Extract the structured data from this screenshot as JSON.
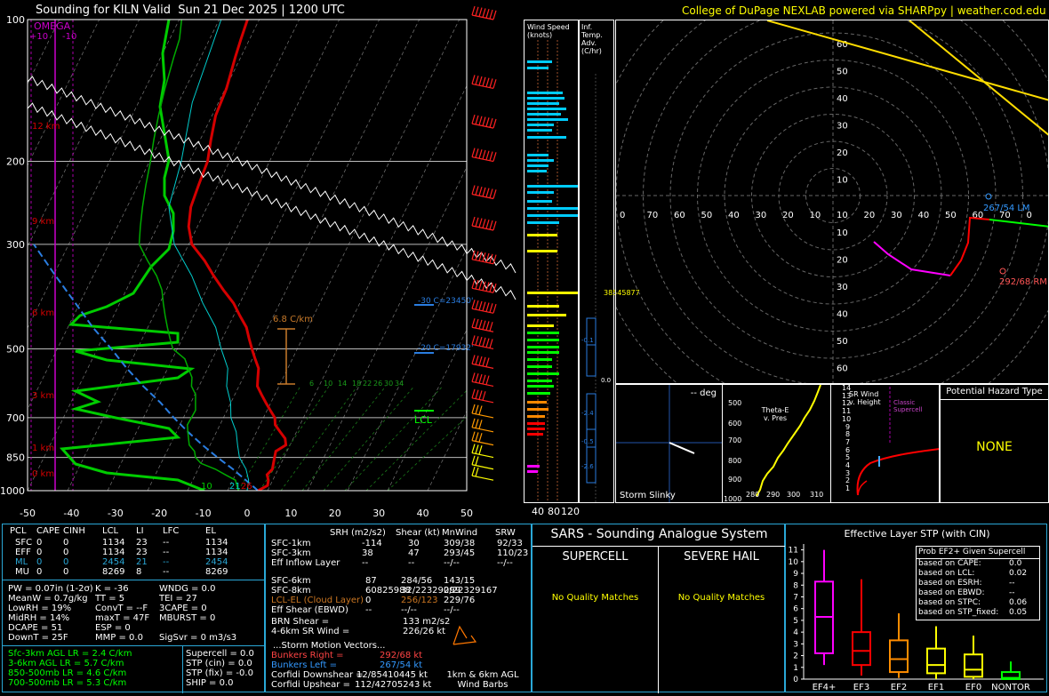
{
  "header": {
    "title": "Sounding for KILN Valid  Sun 21 Dec 2025 | 1200 UTC",
    "credit": "College of DuPage NEXLAB powered via SHARPpy | weather.cod.edu"
  },
  "skewt": {
    "omega_label": "OMEGA",
    "omega_ticks": [
      "+10",
      "-10"
    ],
    "pressure_labels": [
      {
        "p": 100,
        "label": "100"
      },
      {
        "p": 200,
        "label": "200"
      },
      {
        "p": 300,
        "label": "300"
      },
      {
        "p": 500,
        "label": "500"
      },
      {
        "p": 700,
        "label": "700"
      },
      {
        "p": 850,
        "label": "850"
      },
      {
        "p": 1000,
        "label": "1000"
      }
    ],
    "temp_ticks": [
      "-50",
      "-40",
      "-30",
      "-20",
      "-10",
      "0",
      "10",
      "20",
      "30",
      "40",
      "50"
    ],
    "height_labels": [
      "12 km",
      "9 km",
      "6 km",
      "3 km",
      "1 km",
      "0 km"
    ],
    "lapse_label": "6.8 C/km",
    "lcl_label": "LCL",
    "isotherm_labels": [
      "-30 C=23450'",
      "-20 C=17932'"
    ],
    "mixing_ratio_labels": [
      "6",
      "10",
      "14",
      "18",
      "22",
      "26",
      "30",
      "34"
    ],
    "surface_labels": [
      "10",
      "21",
      "26"
    ],
    "profiles": {
      "temperature": [
        [
          1000,
          2.5
        ],
        [
          975,
          4
        ],
        [
          950,
          3.5
        ],
        [
          925,
          2.5
        ],
        [
          900,
          3
        ],
        [
          875,
          2.5
        ],
        [
          850,
          2
        ],
        [
          825,
          1.5
        ],
        [
          800,
          3
        ],
        [
          775,
          2
        ],
        [
          750,
          0
        ],
        [
          725,
          -2
        ],
        [
          700,
          -3
        ],
        [
          675,
          -5
        ],
        [
          650,
          -7
        ],
        [
          625,
          -9
        ],
        [
          600,
          -11
        ],
        [
          575,
          -12
        ],
        [
          550,
          -13
        ],
        [
          525,
          -15
        ],
        [
          500,
          -17
        ],
        [
          475,
          -19
        ],
        [
          450,
          -21
        ],
        [
          425,
          -24
        ],
        [
          400,
          -27
        ],
        [
          375,
          -31
        ],
        [
          350,
          -35
        ],
        [
          325,
          -39
        ],
        [
          300,
          -44
        ],
        [
          275,
          -47
        ],
        [
          250,
          -49
        ],
        [
          225,
          -50
        ],
        [
          200,
          -51
        ],
        [
          180,
          -53
        ],
        [
          160,
          -55
        ],
        [
          140,
          -56
        ],
        [
          120,
          -58
        ],
        [
          110,
          -59
        ],
        [
          100,
          -60
        ]
      ],
      "dewpoint": [
        [
          1000,
          -2
        ],
        [
          975,
          -3
        ],
        [
          950,
          -4
        ],
        [
          925,
          -7
        ],
        [
          900,
          -10
        ],
        [
          875,
          -14
        ],
        [
          850,
          -16
        ],
        [
          825,
          -17
        ],
        [
          800,
          -19
        ],
        [
          775,
          -20
        ],
        [
          750,
          -21
        ],
        [
          725,
          -22
        ],
        [
          700,
          -22
        ],
        [
          675,
          -22
        ],
        [
          650,
          -23
        ],
        [
          625,
          -24
        ],
        [
          600,
          -26
        ],
        [
          575,
          -27
        ],
        [
          550,
          -29
        ],
        [
          525,
          -31
        ],
        [
          500,
          -35
        ],
        [
          475,
          -37
        ],
        [
          450,
          -39
        ],
        [
          425,
          -41
        ],
        [
          400,
          -43
        ],
        [
          375,
          -45
        ],
        [
          350,
          -48
        ],
        [
          325,
          -52
        ],
        [
          300,
          -56
        ],
        [
          275,
          -58
        ],
        [
          250,
          -60
        ],
        [
          225,
          -62
        ],
        [
          200,
          -64
        ],
        [
          180,
          -66
        ],
        [
          160,
          -68
        ],
        [
          140,
          -70
        ],
        [
          120,
          -72
        ],
        [
          110,
          -73
        ],
        [
          100,
          -75
        ]
      ],
      "wetbulb": [
        [
          1000,
          0
        ],
        [
          950,
          -1
        ],
        [
          900,
          -3
        ],
        [
          850,
          -6
        ],
        [
          800,
          -8
        ],
        [
          750,
          -10
        ],
        [
          700,
          -13
        ],
        [
          650,
          -15
        ],
        [
          600,
          -18
        ],
        [
          550,
          -20
        ],
        [
          500,
          -24
        ],
        [
          450,
          -28
        ],
        [
          400,
          -34
        ],
        [
          350,
          -40
        ],
        [
          300,
          -48
        ],
        [
          250,
          -54
        ],
        [
          200,
          -57
        ],
        [
          150,
          -62
        ],
        [
          100,
          -66
        ]
      ],
      "parcel": [
        [
          1000,
          2.5
        ],
        [
          900,
          -6
        ],
        [
          850,
          -11
        ],
        [
          800,
          -16
        ],
        [
          750,
          -21
        ],
        [
          700,
          -26
        ],
        [
          650,
          -31
        ],
        [
          600,
          -37
        ],
        [
          550,
          -43
        ],
        [
          500,
          -49
        ],
        [
          450,
          -56
        ],
        [
          400,
          -63
        ],
        [
          350,
          -71
        ],
        [
          300,
          -80
        ]
      ]
    },
    "wind_barbs": [
      {
        "p": 100,
        "dir": 260,
        "spd": 95
      },
      {
        "p": 140,
        "dir": 255,
        "spd": 95
      },
      {
        "p": 170,
        "dir": 255,
        "spd": 90
      },
      {
        "p": 200,
        "dir": 255,
        "spd": 80
      },
      {
        "p": 240,
        "dir": 255,
        "spd": 80
      },
      {
        "p": 280,
        "dir": 260,
        "spd": 75
      },
      {
        "p": 330,
        "dir": 255,
        "spd": 85
      },
      {
        "p": 380,
        "dir": 260,
        "spd": 80
      },
      {
        "p": 420,
        "dir": 260,
        "spd": 70
      },
      {
        "p": 460,
        "dir": 265,
        "spd": 65
      },
      {
        "p": 500,
        "dir": 265,
        "spd": 60
      },
      {
        "p": 550,
        "dir": 260,
        "spd": 55
      },
      {
        "p": 600,
        "dir": 260,
        "spd": 50
      },
      {
        "p": 650,
        "dir": 265,
        "spd": 45
      },
      {
        "p": 700,
        "dir": 255,
        "spd": 35
      },
      {
        "p": 750,
        "dir": 250,
        "spd": 30
      },
      {
        "p": 800,
        "dir": 235,
        "spd": 30
      },
      {
        "p": 850,
        "dir": 220,
        "spd": 30
      },
      {
        "p": 900,
        "dir": 210,
        "spd": 25
      },
      {
        "p": 950,
        "dir": 200,
        "spd": 20
      }
    ]
  },
  "wind_speed": {
    "title": "Wind Speed (knots)",
    "ticks": [
      "40",
      "80",
      "120"
    ]
  },
  "temp_adv": {
    "title": "Inf. Temp. Adv. (C/hr)",
    "values": [
      "-0.1",
      "0.0",
      "-2.4",
      "-0.5",
      "-2.6"
    ]
  },
  "top_label": "38545877",
  "hodograph": {
    "ring_labels": [
      "70",
      "60",
      "50",
      "40",
      "30",
      "20",
      "10"
    ],
    "x_labels": [
      "0",
      "70",
      "60",
      "50",
      "40",
      "30",
      "20",
      "10",
      "10",
      "20",
      "30",
      "40",
      "50",
      "60",
      "70",
      "0"
    ],
    "lm_label": "267/54 LM",
    "rm_label": "292/68 RM"
  },
  "slinky": {
    "deg": "-- deg",
    "label": "Storm Slinky"
  },
  "theta": {
    "label": "Theta-E v. Pres",
    "x_ticks": [
      "280",
      "290",
      "300",
      "310"
    ],
    "y_ticks": [
      "500",
      "600",
      "700",
      "800",
      "900",
      "1000"
    ],
    "y_top": "370"
  },
  "srwind": {
    "label": "SR Wind v. Height",
    "legend": "Classic Supercell",
    "y_ticks": [
      "14",
      "13",
      "12",
      "11",
      "10",
      "9",
      "8",
      "7",
      "6",
      "5",
      "4",
      "3",
      "2",
      "1"
    ]
  },
  "hazard": {
    "title": "Potential Hazard Type",
    "value": "NONE"
  },
  "parcels": {
    "headers": [
      "PCL",
      "CAPE",
      "CINH",
      "LCL",
      "LI",
      "LFC",
      "EL"
    ],
    "rows": [
      [
        "SFC",
        "0",
        "0",
        "1134",
        "23",
        "--",
        "1134"
      ],
      [
        "EFF",
        "0",
        "0",
        "1134",
        "23",
        "--",
        "1134"
      ],
      [
        "ML",
        "0",
        "0",
        "2454",
        "21",
        "--",
        "2454"
      ],
      [
        "MU",
        "0",
        "0",
        "8269",
        "8",
        "--",
        "8269"
      ]
    ]
  },
  "indices": [
    [
      "PW = 0.07in (1-2σ)",
      "K = -36",
      "WNDG = 0.0"
    ],
    [
      "MeanW = 0.7g/kg",
      "TT = 5",
      "TEI = 27"
    ],
    [
      "LowRH = 19%",
      "ConvT = --F",
      "3CAPE = 0"
    ],
    [
      "MidRH = 14%",
      "maxT = 47F",
      "MBURST = 0"
    ],
    [
      "DCAPE = 51",
      "ESP = 0",
      ""
    ],
    [
      "DownT = 25F",
      "MMP = 0.0",
      "SigSvr = 0 m3/s3"
    ]
  ],
  "lapse_rates": [
    "Sfc-3km AGL LR = 2.4 C/km",
    "3-6km AGL LR = 5.7 C/km",
    "850-500mb LR = 4.6 C/km",
    "700-500mb LR = 5.3 C/km"
  ],
  "composites": [
    "Supercell = 0.0",
    "STP (cin) = 0.0",
    "STP (fix) = -0.0",
    "SHIP = 0.0"
  ],
  "kinematics": {
    "headers": [
      "SRH (m2/s2)",
      "Shear (kt)",
      "MnWind",
      "SRW"
    ],
    "rows": [
      [
        "SFC-1km",
        "-114",
        "30",
        "309/38",
        "92/33"
      ],
      [
        "SFC-3km",
        "38",
        "47",
        "293/45",
        "110/23"
      ],
      [
        "Eff Inflow Layer",
        "--",
        "--",
        "--/--",
        "--/--"
      ],
      [
        "",
        "",
        " ",
        "",
        ""
      ],
      [
        "SFC-6km",
        "87",
        "284/56",
        "143/15",
        ""
      ],
      [
        "SFC-8km",
        "60825988",
        "32/22329099",
        "2/22329167",
        ""
      ],
      [
        "LCL-EL (Cloud Layer)",
        "0",
        "256/123",
        "229/76",
        ""
      ],
      [
        "Eff Shear (EBWD)",
        "--",
        "--/--",
        "--/--",
        ""
      ]
    ],
    "brn": "BRN Shear =",
    "brn_val": "133 m2/s2",
    "sr_wind": "4-6km SR Wind =",
    "sr_wind_val": "226/26 kt",
    "storm_motion_title": "...Storm Motion Vectors...",
    "bunkers_right": "Bunkers Right =",
    "bunkers_right_val": "292/68 kt",
    "bunkers_left": "Bunkers Left =",
    "bunkers_left_val": "267/54 kt",
    "corfidi_down": "Corfidi Downshear =",
    "corfidi_down_val": "12/85410445 kt",
    "corfidi_up": "Corfidi Upshear =",
    "corfidi_up_val": "112/42705243 kt",
    "barbs_label": "1km & 6km AGL\nWind Barbs"
  },
  "sars": {
    "title": "SARS - Sounding Analogue System",
    "supercell": "SUPERCELL",
    "hail": "SEVERE HAIL",
    "supercell_result": "No Quality Matches",
    "hail_result": "No Quality Matches"
  },
  "stp": {
    "title": "Effective Layer STP (with CIN)",
    "legend_title": "Prob EF2+ Given Supercell",
    "legend_rows": [
      [
        "based on CAPE:",
        "0.0"
      ],
      [
        "based on LCL:",
        "0.02"
      ],
      [
        "based on ESRH:",
        "--"
      ],
      [
        "based on EBWD:",
        "--"
      ],
      [
        "based on STPC:",
        "0.06"
      ],
      [
        "based on STP_fixed:",
        "0.05"
      ]
    ],
    "y_ticks": [
      "11",
      "10",
      "9",
      "8",
      "7",
      "6",
      "5",
      "4",
      "3",
      "2",
      "1",
      "0"
    ],
    "categories": [
      "EF4+",
      "EF3",
      "EF2",
      "EF1",
      "EF0",
      "NONTOR"
    ],
    "colors": [
      "#ff00ff",
      "#ff0000",
      "#ff8c00",
      "#ffff00",
      "#ffff00",
      "#00ff00"
    ],
    "boxes": [
      {
        "low": 1.2,
        "q1": 2.2,
        "med": 5.3,
        "q3": 8.3,
        "high": 11
      },
      {
        "low": 0.3,
        "q1": 1.2,
        "med": 2.4,
        "q3": 4.0,
        "high": 8.5
      },
      {
        "low": 0.1,
        "q1": 0.6,
        "med": 1.7,
        "q3": 3.3,
        "high": 5.6
      },
      {
        "low": 0.0,
        "q1": 0.5,
        "med": 1.2,
        "q3": 2.6,
        "high": 4.5
      },
      {
        "low": 0.0,
        "q1": 0.2,
        "med": 0.8,
        "q3": 2.1,
        "high": 3.7
      },
      {
        "low": 0.0,
        "q1": 0.0,
        "med": 0.1,
        "q3": 0.6,
        "high": 1.5
      }
    ]
  }
}
